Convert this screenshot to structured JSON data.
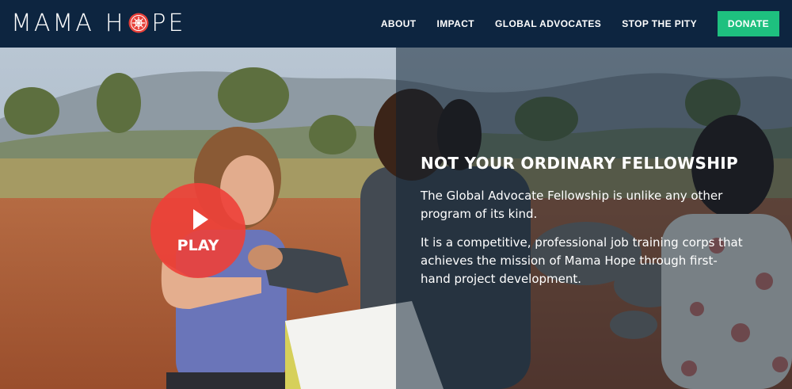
{
  "brand": {
    "name_left": "MAMA",
    "name_right_h": "H",
    "name_right_rest": "PE"
  },
  "nav": {
    "items": [
      "ABOUT",
      "IMPACT",
      "GLOBAL ADVOCATES",
      "STOP THE PITY"
    ],
    "donate_label": "DONATE"
  },
  "hero": {
    "play_label": "PLAY",
    "heading": "NOT YOUR ORDINARY FELLOWSHIP",
    "paragraph_1": "The Global Advocate Fellowship is unlike any other program of its kind.",
    "paragraph_2": "It is a competitive, professional job training corps that achieves the mission of Mama Hope through first-hand project development."
  },
  "colors": {
    "header_bg": "#0d2540",
    "donate_bg": "#1ec07f",
    "play_bg": "#ee4038",
    "logo_accent": "#e8413a"
  }
}
